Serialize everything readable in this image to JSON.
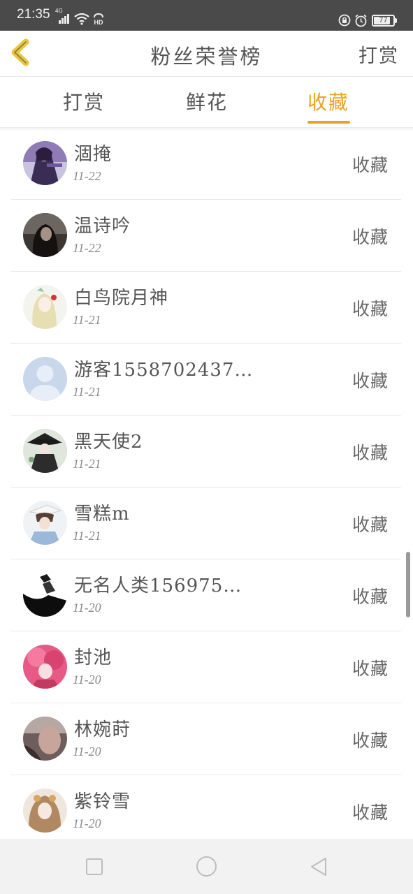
{
  "status_bar": {
    "time": "21:35",
    "signal_label": "4G",
    "hd_label": "HD",
    "battery": "77",
    "battery_level": 0.77,
    "icons": [
      "signal-icon",
      "wifi-icon",
      "hd-icon",
      "lock-rotation-icon",
      "alarm-icon",
      "battery-icon"
    ]
  },
  "header": {
    "title": "粉丝荣誉榜",
    "action_label": "打赏",
    "back_icon": "chevron-left-icon",
    "accent_color": "#e8a325"
  },
  "tabs": [
    {
      "label": "打赏",
      "active": false
    },
    {
      "label": "鲜花",
      "active": false
    },
    {
      "label": "收藏",
      "active": true
    }
  ],
  "list": {
    "items": [
      {
        "name": "涸掩",
        "date": "11-22",
        "action": "收藏"
      },
      {
        "name": "温诗吟",
        "date": "11-22",
        "action": "收藏"
      },
      {
        "name": "白鸟院月神",
        "date": "11-21",
        "action": "收藏"
      },
      {
        "name": "游客1558702437…",
        "date": "11-21",
        "action": "收藏"
      },
      {
        "name": "黑天使2",
        "date": "11-21",
        "action": "收藏"
      },
      {
        "name": "雪糕m",
        "date": "11-21",
        "action": "收藏"
      },
      {
        "name": "无名人类156975…",
        "date": "11-20",
        "action": "收藏"
      },
      {
        "name": "封池",
        "date": "11-20",
        "action": "收藏"
      },
      {
        "name": "林婉莳",
        "date": "11-20",
        "action": "收藏"
      },
      {
        "name": "紫铃雪",
        "date": "11-20",
        "action": "收藏"
      }
    ]
  },
  "nav_bar": {
    "icons": [
      "recent-apps-icon",
      "home-icon",
      "back-icon"
    ]
  }
}
